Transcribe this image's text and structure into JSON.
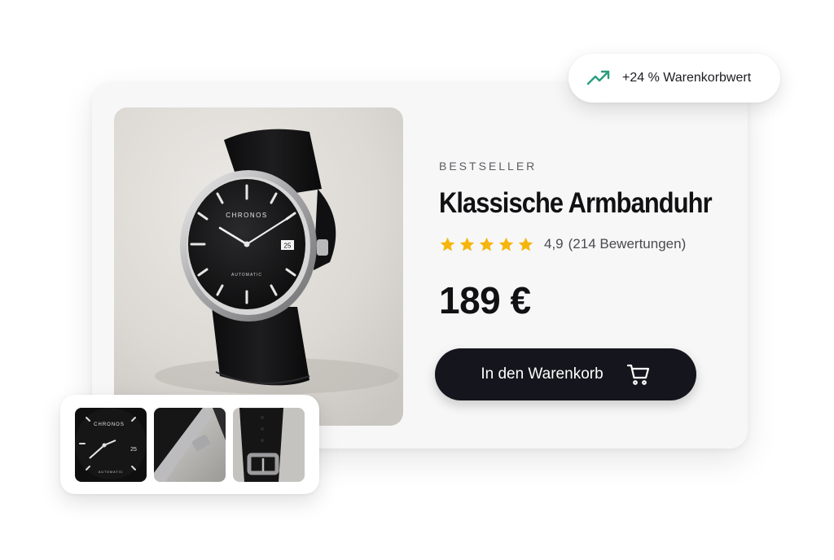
{
  "badge": {
    "text": "+24 % Warenkorbwert",
    "icon": "trending-up-icon",
    "color": "#2a9d7f"
  },
  "product": {
    "eyebrow": "BESTSELLER",
    "title": "Klassische Armbanduhr",
    "rating": {
      "stars": 5,
      "value": "4,9",
      "count": "(214 Bewertungen)",
      "star_color": "#f5b50a"
    },
    "price": "189 €",
    "watch_brand": "CHRONOS",
    "watch_subtitle": "AUTOMATIC",
    "watch_date": "25"
  },
  "cart_button": {
    "label": "In den Warenkorb",
    "icon": "shopping-cart-icon",
    "background": "#15151d"
  },
  "thumbnails": [
    {
      "name": "thumbnail-dial",
      "brand": "CHRONOS",
      "subtitle": "AUTOMATIC",
      "date": "25"
    },
    {
      "name": "thumbnail-crown"
    },
    {
      "name": "thumbnail-strap"
    }
  ]
}
